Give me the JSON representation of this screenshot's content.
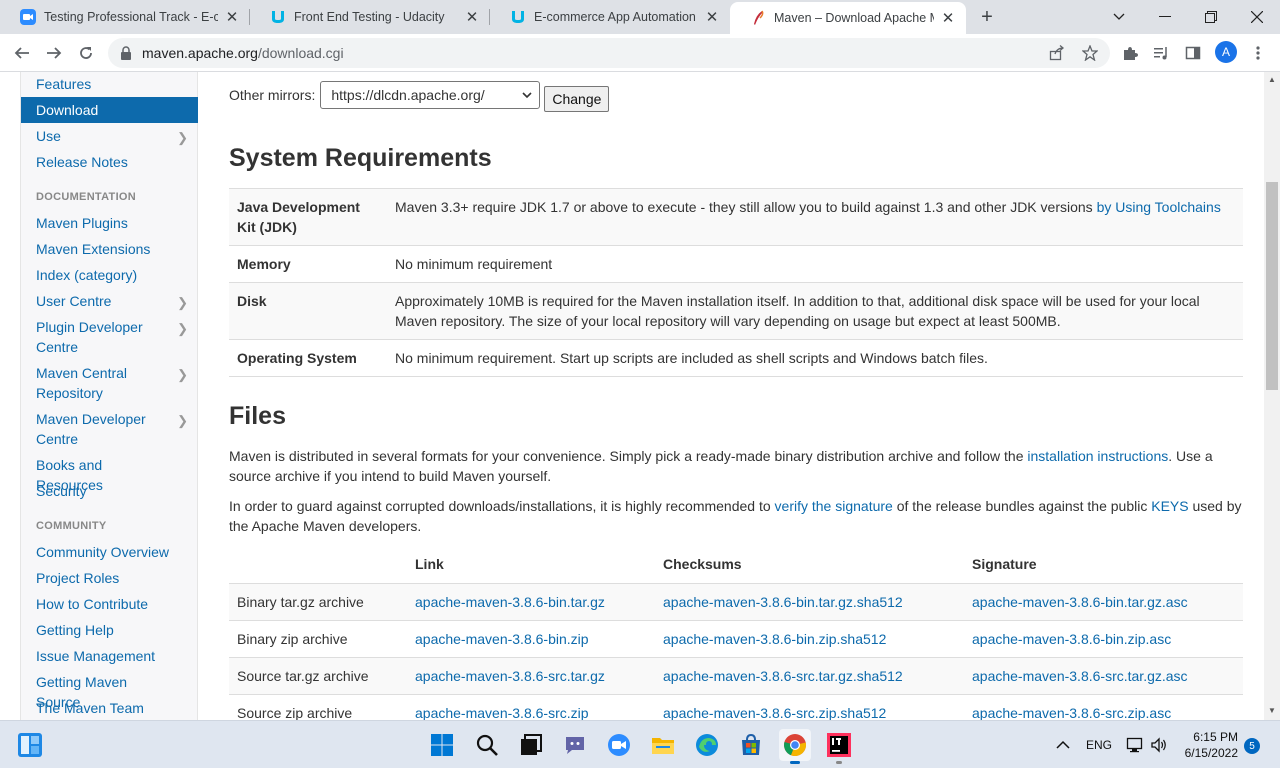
{
  "browser": {
    "tabs": [
      {
        "title": "Testing Professional Track - E-cor",
        "icon": "zoom-favicon",
        "active": false
      },
      {
        "title": "Front End Testing - Udacity",
        "icon": "udacity-favicon",
        "active": false
      },
      {
        "title": "E-commerce App Automation Te",
        "icon": "udacity-favicon",
        "active": false
      },
      {
        "title": "Maven – Download Apache Mave",
        "icon": "maven-feather-favicon",
        "active": true
      }
    ],
    "new_tab": "+",
    "url_host": "maven.apache.org",
    "url_path": "/download.cgi",
    "profile_initial": "A"
  },
  "sidebar": {
    "items_top": [
      {
        "label": "Features",
        "chevron": false,
        "active": false
      },
      {
        "label": "Download",
        "chevron": false,
        "active": true
      },
      {
        "label": "Use",
        "chevron": true,
        "active": false
      },
      {
        "label": "Release Notes",
        "chevron": false,
        "active": false
      }
    ],
    "documentation_header": "DOCUMENTATION",
    "documentation": [
      {
        "label": "Maven Plugins",
        "chevron": false
      },
      {
        "label": "Maven Extensions",
        "chevron": false
      },
      {
        "label": "Index (category)",
        "chevron": false
      },
      {
        "label": "User Centre",
        "chevron": true
      },
      {
        "label": "Plugin Developer Centre",
        "chevron": true
      },
      {
        "label": "Maven Central Repository",
        "chevron": true
      },
      {
        "label": "Maven Developer Centre",
        "chevron": true
      },
      {
        "label": "Books and Resources",
        "chevron": false
      },
      {
        "label": "Security",
        "chevron": false
      }
    ],
    "community_header": "COMMUNITY",
    "community": [
      {
        "label": "Community Overview"
      },
      {
        "label": "Project Roles"
      },
      {
        "label": "How to Contribute"
      },
      {
        "label": "Getting Help"
      },
      {
        "label": "Issue Management"
      },
      {
        "label": "Getting Maven Source"
      },
      {
        "label": "The Maven Team"
      }
    ]
  },
  "mirrors": {
    "label": "Other mirrors:",
    "selected": "https://dlcdn.apache.org/",
    "button": "Change"
  },
  "system_requirements": {
    "heading": "System Requirements",
    "rows": [
      {
        "key": "Java Development Kit (JDK)",
        "value": "Maven 3.3+ require JDK 1.7 or above to execute - they still allow you to build against 1.3 and other JDK versions ",
        "link": "by Using Toolchains"
      },
      {
        "key": "Memory",
        "value": "No minimum requirement",
        "link": ""
      },
      {
        "key": "Disk",
        "value": "Approximately 10MB is required for the Maven installation itself. In addition to that, additional disk space will be used for your local Maven repository. The size of your local repository will vary depending on usage but expect at least 500MB.",
        "link": ""
      },
      {
        "key": "Operating System",
        "value": "No minimum requirement. Start up scripts are included as shell scripts and Windows batch files.",
        "link": ""
      }
    ]
  },
  "files": {
    "heading": "Files",
    "para1_a": "Maven is distributed in several formats for your convenience. Simply pick a ready-made binary distribution archive and follow the ",
    "para1_link": "installation instructions",
    "para1_b": ". Use a source archive if you intend to build Maven yourself.",
    "para2_a": "In order to guard against corrupted downloads/installations, it is highly recommended to ",
    "para2_link1": "verify the signature",
    "para2_b": " of the release bundles against the public ",
    "para2_link2": "KEYS",
    "para2_c": " used by the Apache Maven developers.",
    "columns": [
      "",
      "Link",
      "Checksums",
      "Signature"
    ],
    "rows": [
      {
        "type": "Binary tar.gz archive",
        "link": "apache-maven-3.8.6-bin.tar.gz",
        "checksum": "apache-maven-3.8.6-bin.tar.gz.sha512",
        "signature": "apache-maven-3.8.6-bin.tar.gz.asc"
      },
      {
        "type": "Binary zip archive",
        "link": "apache-maven-3.8.6-bin.zip",
        "checksum": "apache-maven-3.8.6-bin.zip.sha512",
        "signature": "apache-maven-3.8.6-bin.zip.asc"
      },
      {
        "type": "Source tar.gz archive",
        "link": "apache-maven-3.8.6-src.tar.gz",
        "checksum": "apache-maven-3.8.6-src.tar.gz.sha512",
        "signature": "apache-maven-3.8.6-src.tar.gz.asc"
      },
      {
        "type": "Source zip archive",
        "link": "apache-maven-3.8.6-src.zip",
        "checksum": "apache-maven-3.8.6-src.zip.sha512",
        "signature": "apache-maven-3.8.6-src.zip.asc"
      }
    ]
  },
  "taskbar": {
    "apps": [
      "windows-start-icon",
      "search-icon",
      "task-view-icon",
      "teams-chat-icon",
      "zoom-icon",
      "file-explorer-icon",
      "edge-icon",
      "microsoft-store-icon",
      "chrome-icon",
      "intellij-icon"
    ],
    "language": "ENG",
    "time": "6:15 PM",
    "date": "6/15/2022",
    "notifications": "5"
  },
  "colors": {
    "link": "#0d6aac",
    "sidebar_active_bg": "#0d6aac",
    "tabstrip_bg": "#dee1e6",
    "taskbar_bg": "#dfe6f0"
  }
}
